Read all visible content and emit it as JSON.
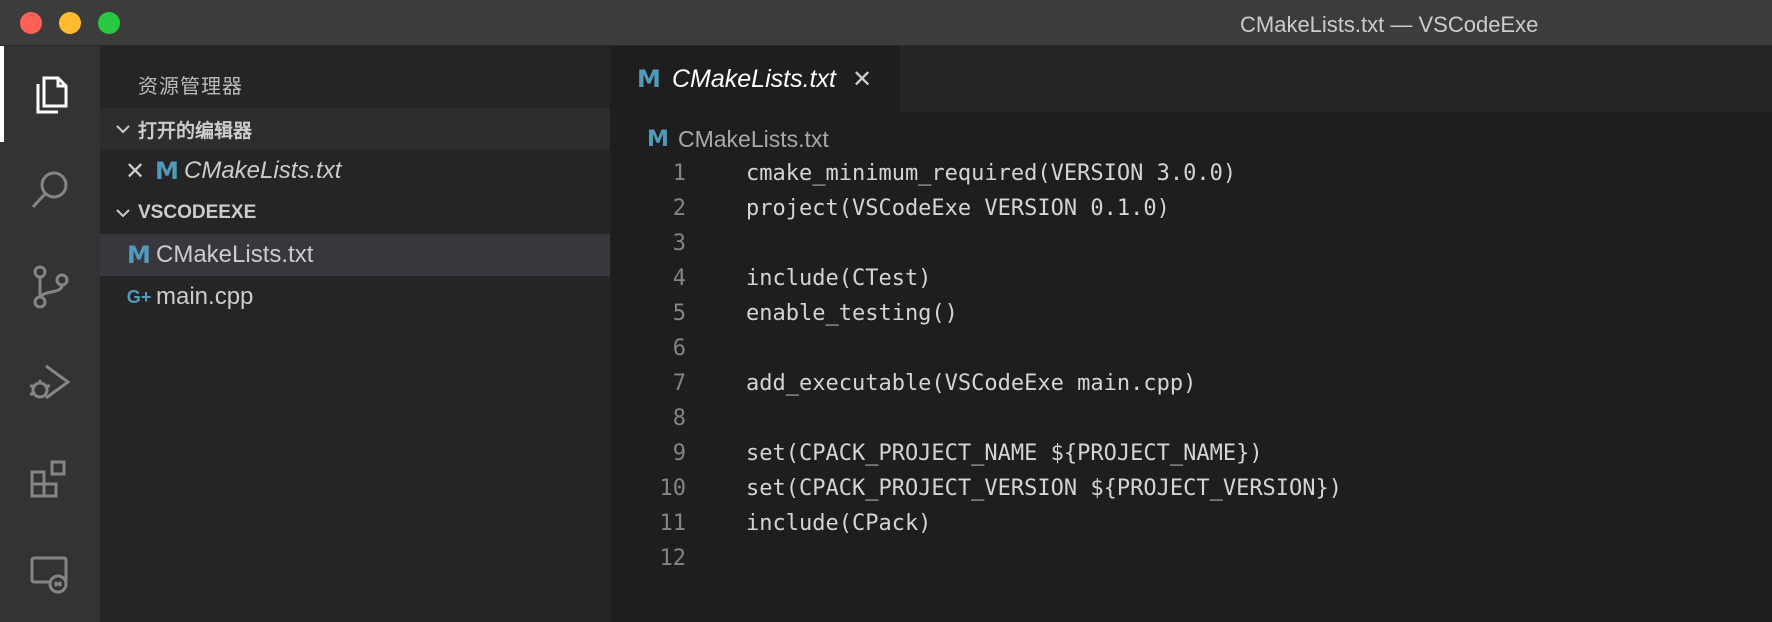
{
  "window": {
    "title": "CMakeLists.txt — VSCodeExe"
  },
  "activity_bar": {
    "items": [
      {
        "name": "explorer",
        "icon": "files-icon",
        "active": true
      },
      {
        "name": "search",
        "icon": "search-icon",
        "active": false
      },
      {
        "name": "source-control",
        "icon": "source-control-icon",
        "active": false
      },
      {
        "name": "run-debug",
        "icon": "run-debug-icon",
        "active": false
      },
      {
        "name": "extensions",
        "icon": "extensions-icon",
        "active": false
      },
      {
        "name": "remote-explorer",
        "icon": "remote-explorer-icon",
        "active": false
      }
    ]
  },
  "sidebar": {
    "title": "资源管理器",
    "open_editors": {
      "label": "打开的编辑器",
      "items": [
        {
          "name": "CMakeLists.txt",
          "icon": "M"
        }
      ]
    },
    "workspace": {
      "label": "VSCODEEXE",
      "files": [
        {
          "name": "CMakeLists.txt",
          "icon": "M",
          "selected": true
        },
        {
          "name": "main.cpp",
          "icon": "G+",
          "selected": false
        }
      ]
    }
  },
  "editor": {
    "tab": {
      "label": "CMakeLists.txt",
      "icon": "M"
    },
    "breadcrumb": {
      "label": "CMakeLists.txt",
      "icon": "M"
    },
    "lines": [
      {
        "n": "1",
        "text": "cmake_minimum_required(VERSION 3.0.0)"
      },
      {
        "n": "2",
        "text": "project(VSCodeExe VERSION 0.1.0)"
      },
      {
        "n": "3",
        "text": ""
      },
      {
        "n": "4",
        "text": "include(CTest)"
      },
      {
        "n": "5",
        "text": "enable_testing()"
      },
      {
        "n": "6",
        "text": ""
      },
      {
        "n": "7",
        "text": "add_executable(VSCodeExe main.cpp)"
      },
      {
        "n": "8",
        "text": ""
      },
      {
        "n": "9",
        "text": "set(CPACK_PROJECT_NAME ${PROJECT_NAME})"
      },
      {
        "n": "10",
        "text": "set(CPACK_PROJECT_VERSION ${PROJECT_VERSION})"
      },
      {
        "n": "11",
        "text": "include(CPack)"
      },
      {
        "n": "12",
        "text": ""
      }
    ]
  },
  "colors": {
    "titlebar": "#3c3c3c",
    "activity_bar": "#333333",
    "sidebar": "#252526",
    "editor": "#1e1e1e",
    "selection": "#37373d",
    "file_icon_blue": "#519aba"
  }
}
